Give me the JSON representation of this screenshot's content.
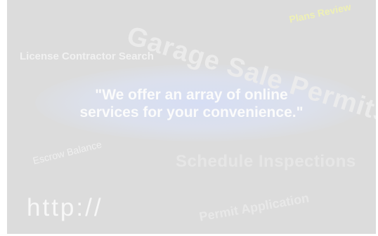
{
  "banner": {
    "background_color": "#dcdcdc",
    "words": {
      "garage": "Garage Sale Permits",
      "plans": "Plans Review",
      "license": "License Contractor Search",
      "escrow": "Escrow Balance",
      "schedule": "Schedule Inspections",
      "http": "http://",
      "permit": "Permit Application"
    },
    "quote": {
      "line1": "\"We offer an array of online",
      "line2": "services for your convenience.\""
    }
  }
}
